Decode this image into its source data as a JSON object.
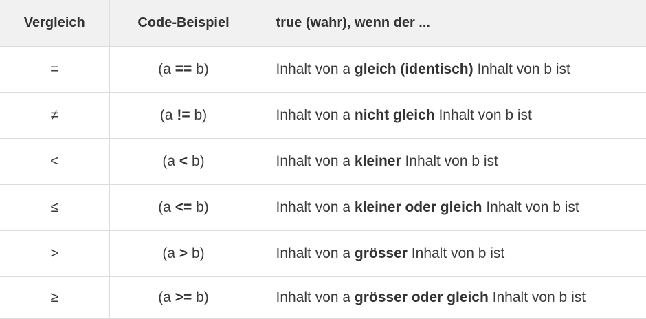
{
  "table": {
    "headers": [
      "Vergleich",
      "Code-Beispiel",
      "true (wahr), wenn der ..."
    ],
    "rows": [
      {
        "symbol": "=",
        "code": {
          "pre": "(a ",
          "op": "==",
          "post": " b)"
        },
        "desc": {
          "pre": "Inhalt von a ",
          "bold": "gleich (identisch)",
          "post": " Inhalt von b ist"
        }
      },
      {
        "symbol": "≠",
        "code": {
          "pre": "(a ",
          "op": "!=",
          "post": " b)"
        },
        "desc": {
          "pre": "Inhalt von a ",
          "bold": "nicht gleich",
          "post": " Inhalt von b ist"
        }
      },
      {
        "symbol": "<",
        "code": {
          "pre": "(a ",
          "op": "<",
          "post": " b)"
        },
        "desc": {
          "pre": "Inhalt von a ",
          "bold": "kleiner",
          "post": " Inhalt von b ist"
        }
      },
      {
        "symbol": "≤",
        "code": {
          "pre": "(a ",
          "op": "<=",
          "post": " b)"
        },
        "desc": {
          "pre": "Inhalt von a ",
          "bold": "kleiner oder gleich",
          "post": " Inhalt von b ist"
        }
      },
      {
        "symbol": ">",
        "code": {
          "pre": "(a ",
          "op": ">",
          "post": " b)"
        },
        "desc": {
          "pre": "Inhalt von a ",
          "bold": "grösser",
          "post": " Inhalt von b ist"
        }
      },
      {
        "symbol": "≥",
        "code": {
          "pre": "(a ",
          "op": ">=",
          "post": " b)"
        },
        "desc": {
          "pre": "Inhalt von a ",
          "bold": "grösser oder gleich",
          "post": " Inhalt von b ist"
        }
      }
    ]
  }
}
